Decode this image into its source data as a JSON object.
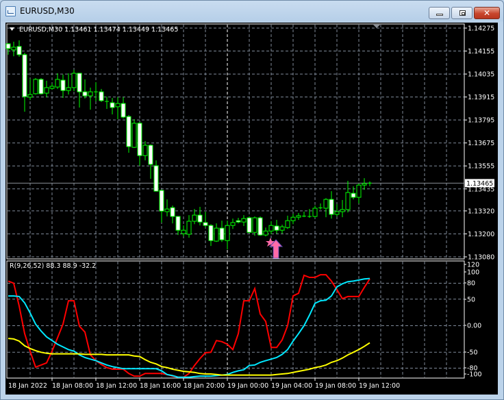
{
  "window": {
    "title": "EURUSD,M30"
  },
  "chart": {
    "header": "EURUSD,M30  1.13461 1.13474 1.13449 1.13465",
    "current_price": "1.13465",
    "price_axis": [
      "1.14275",
      "1.14155",
      "1.14035",
      "1.13915",
      "1.13795",
      "1.13675",
      "1.13555",
      "1.13435",
      "1.13320",
      "1.13200",
      "1.13080"
    ],
    "time_axis": [
      "18 Jan 2022",
      "18 Jan 08:00",
      "18 Jan 12:00",
      "18 Jan 16:00",
      "18 Jan 20:00",
      "19 Jan 00:00",
      "19 Jan 04:00",
      "19 Jan 08:00",
      "19 Jan 12:00"
    ],
    "colors": {
      "background": "#000000",
      "candle": "#00ff00",
      "bear_body": "#ffffff",
      "grid": "#7f8a99",
      "arrow": "#ff6aa8"
    },
    "candles_ohlc": [
      [
        1.14193,
        1.14196,
        1.14136,
        1.14168
      ],
      [
        1.14161,
        1.14204,
        1.14128,
        1.14175
      ],
      [
        1.14179,
        1.14211,
        1.14125,
        1.14136
      ],
      [
        1.14136,
        1.14146,
        1.13838,
        1.13917
      ],
      [
        1.13914,
        1.1401,
        1.13899,
        1.13928
      ],
      [
        1.13932,
        1.14014,
        1.13928,
        1.14007
      ],
      [
        1.14007,
        1.14014,
        1.13928,
        1.13932
      ],
      [
        1.13935,
        1.14,
        1.13914,
        1.13964
      ],
      [
        1.1396,
        1.13985,
        1.13953,
        1.13971
      ],
      [
        1.13967,
        1.14039,
        1.13957,
        1.14007
      ],
      [
        1.14003,
        1.14032,
        1.1391,
        1.13949
      ],
      [
        1.13949,
        1.14039,
        1.13928,
        1.13964
      ],
      [
        1.13964,
        1.14057,
        1.13946,
        1.14039
      ],
      [
        1.14039,
        1.14039,
        1.1386,
        1.13942
      ],
      [
        1.13942,
        1.14007,
        1.13907,
        1.13921
      ],
      [
        1.13921,
        1.13964,
        1.13849,
        1.13942
      ],
      [
        1.13942,
        1.13992,
        1.13892,
        1.1394
      ],
      [
        1.13942,
        1.13957,
        1.13889,
        1.13896
      ],
      [
        1.13892,
        1.13917,
        1.13853,
        1.13889
      ],
      [
        1.13885,
        1.1391,
        1.13824,
        1.1386
      ],
      [
        1.13864,
        1.13914,
        1.13799,
        1.13881
      ],
      [
        1.13881,
        1.13914,
        1.13803,
        1.1381
      ],
      [
        1.13813,
        1.13821,
        1.13624,
        1.13656
      ],
      [
        1.13652,
        1.13799,
        1.13649,
        1.13778
      ],
      [
        1.13778,
        1.13785,
        1.13556,
        1.13609
      ],
      [
        1.13609,
        1.13685,
        1.13584,
        1.13663
      ],
      [
        1.13663,
        1.13667,
        1.13488,
        1.13563
      ],
      [
        1.13556,
        1.13584,
        1.13423,
        1.13423
      ],
      [
        1.13427,
        1.1343,
        1.13259,
        1.13319
      ],
      [
        1.13316,
        1.1338,
        1.13291,
        1.1333
      ],
      [
        1.13337,
        1.13348,
        1.13255,
        1.13291
      ],
      [
        1.13291,
        1.13291,
        1.13194,
        1.13219
      ],
      [
        1.13201,
        1.13244,
        1.13187,
        1.13219
      ],
      [
        1.13198,
        1.13298,
        1.1318,
        1.13266
      ],
      [
        1.13266,
        1.1333,
        1.13251,
        1.13298
      ],
      [
        1.13298,
        1.13341,
        1.13244,
        1.13262
      ],
      [
        1.13259,
        1.13316,
        1.13233,
        1.13244
      ],
      [
        1.13244,
        1.13251,
        1.13137,
        1.13165
      ],
      [
        1.13162,
        1.13255,
        1.13158,
        1.1323
      ],
      [
        1.1323,
        1.13269,
        1.13158,
        1.13169
      ],
      [
        1.13165,
        1.13269,
        1.13119,
        1.13244
      ],
      [
        1.13244,
        1.1328,
        1.13226,
        1.13259
      ],
      [
        1.13269,
        1.13284,
        1.13255,
        1.13262
      ],
      [
        1.13262,
        1.13298,
        1.13241,
        1.1328
      ],
      [
        1.13284,
        1.13291,
        1.13205,
        1.13208
      ],
      [
        1.13208,
        1.13291,
        1.1319,
        1.13284
      ],
      [
        1.13284,
        1.13291,
        1.1319,
        1.13194
      ],
      [
        1.13194,
        1.13233,
        1.13187,
        1.13215
      ],
      [
        1.13215,
        1.13266,
        1.13198,
        1.13244
      ],
      [
        1.13241,
        1.13273,
        1.13201,
        1.13219
      ],
      [
        1.13219,
        1.13248,
        1.13201,
        1.13237
      ],
      [
        1.13233,
        1.13295,
        1.13226,
        1.13269
      ],
      [
        1.13269,
        1.13305,
        1.13251,
        1.13287
      ],
      [
        1.13287,
        1.13309,
        1.13273,
        1.13295
      ],
      [
        1.13291,
        1.13316,
        1.13287,
        1.13293
      ],
      [
        1.13291,
        1.1333,
        1.13284,
        1.1329
      ],
      [
        1.13291,
        1.13348,
        1.13284,
        1.13334
      ],
      [
        1.13334,
        1.13359,
        1.13327,
        1.13336
      ],
      [
        1.13334,
        1.13387,
        1.13287,
        1.1338
      ],
      [
        1.1338,
        1.13423,
        1.1328,
        1.13302
      ],
      [
        1.13302,
        1.13355,
        1.13291,
        1.13316
      ],
      [
        1.13316,
        1.13377,
        1.13287,
        1.13327
      ],
      [
        1.13327,
        1.13477,
        1.13312,
        1.13416
      ],
      [
        1.13412,
        1.13448,
        1.1338,
        1.13391
      ],
      [
        1.13391,
        1.13463,
        1.13359,
        1.13455
      ],
      [
        1.13455,
        1.13491,
        1.1343,
        1.13463
      ],
      [
        1.13461,
        1.13474,
        1.13449,
        1.13465
      ]
    ],
    "buy_arrow_bar": 48
  },
  "indicator": {
    "header": "R(9,26,52) 88.3 88.9 -32.2",
    "axis": [
      "120",
      "100",
      "80",
      "50",
      "0.00",
      "-50",
      "-80",
      "-100"
    ],
    "axis_values": [
      120,
      100,
      80,
      50,
      0,
      -50,
      -80,
      -100
    ],
    "grid_levels": [
      80,
      50,
      0,
      -50,
      -80
    ],
    "series": [
      {
        "color": "#ff0000",
        "values": [
          84,
          80,
          37,
          -15,
          -48,
          -78,
          -74,
          -70,
          -48,
          -23,
          3,
          47,
          47,
          -1,
          -12,
          -55,
          -66,
          -73,
          -79,
          -82,
          -82,
          -82,
          -90,
          -95,
          -95,
          -90,
          -90,
          -90,
          -90,
          -92,
          -95,
          -97,
          -97,
          -90,
          -75,
          -62,
          -51,
          -50,
          -28,
          -30,
          -35,
          -45,
          -15,
          47,
          47,
          70,
          22,
          8,
          -41,
          -41,
          -27,
          0,
          56,
          61,
          95,
          91,
          91,
          96,
          96,
          84,
          68,
          51,
          55,
          55,
          55,
          72,
          88.3
        ]
      },
      {
        "color": "#00e8ff",
        "values": [
          56,
          56,
          55,
          43,
          24,
          3,
          -10,
          -21,
          -28,
          -35,
          -40,
          -45,
          -48,
          -55,
          -60,
          -63,
          -66,
          -70,
          -74,
          -77,
          -79,
          -81,
          -81,
          -81,
          -81,
          -81,
          -81,
          -81,
          -85,
          -92,
          -94,
          -97,
          -97,
          -97,
          -96,
          -95,
          -95,
          -95,
          -94,
          -93,
          -92,
          -88,
          -85,
          -83,
          -75,
          -74,
          -69,
          -66,
          -63,
          -60,
          -54,
          -45,
          -29,
          -15,
          0,
          20,
          42,
          47,
          48,
          56,
          73,
          79,
          83,
          84,
          86,
          88,
          88.9
        ]
      },
      {
        "color": "#ffff00",
        "values": [
          -24,
          -25,
          -29,
          -38,
          -43,
          -47,
          -50,
          -52,
          -53,
          -53,
          -53,
          -53,
          -53,
          -53,
          -54,
          -54,
          -54,
          -54,
          -55,
          -55,
          -55,
          -55,
          -55,
          -57,
          -58,
          -64,
          -69,
          -72,
          -77,
          -79,
          -82,
          -84,
          -86,
          -87,
          -88,
          -90,
          -91,
          -91,
          -92,
          -93,
          -93,
          -93,
          -93,
          -93,
          -93,
          -93,
          -93,
          -93,
          -93,
          -92,
          -91,
          -90,
          -88,
          -86,
          -84,
          -82,
          -79,
          -77,
          -74,
          -69,
          -66,
          -61,
          -55,
          -50,
          -45,
          -39,
          -32.2
        ]
      }
    ]
  }
}
